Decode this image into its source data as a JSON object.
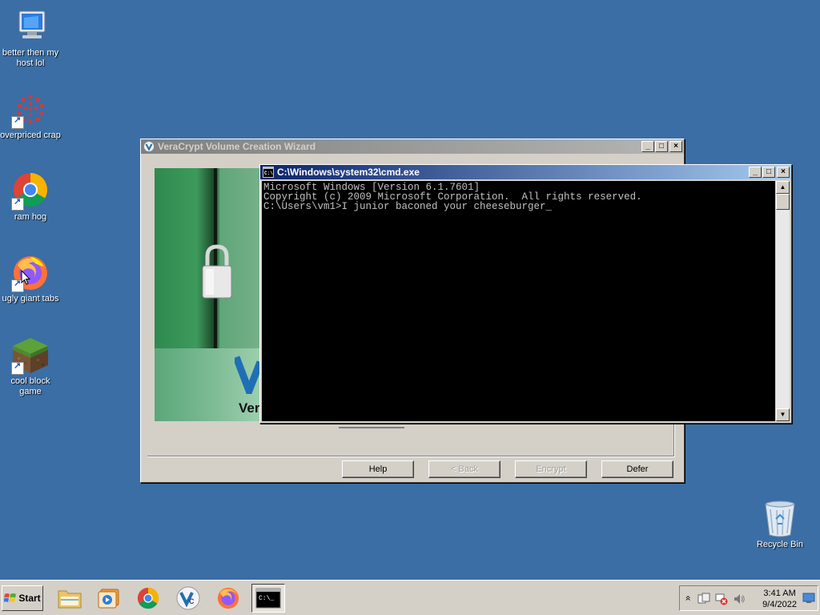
{
  "desktop": {
    "icons": [
      {
        "label": "better then my host lol",
        "icon": "computer-icon"
      },
      {
        "label": "overpriced crap",
        "icon": "red-dots-icon"
      },
      {
        "label": "ram hog",
        "icon": "chrome-icon"
      },
      {
        "label": "ugly giant tabs",
        "icon": "firefox-icon"
      },
      {
        "label": "cool block game",
        "icon": "minecraft-grass-icon"
      },
      {
        "label": "Recycle Bin",
        "icon": "recycle-bin-icon"
      }
    ]
  },
  "veracrypt": {
    "title": "VeraCrypt Volume Creation Wizard",
    "banner_text": "Ver",
    "buttons": {
      "help": "Help",
      "back": "< Back",
      "next": "Encrypt",
      "cancel": "Defer"
    }
  },
  "cmd": {
    "title": "C:\\Windows\\system32\\cmd.exe",
    "lines": [
      "Microsoft Windows [Version 6.1.7601]",
      "Copyright (c) 2009 Microsoft Corporation.  All rights reserved.",
      "",
      "C:\\Users\\vm1>I junior baconed your cheeseburger_"
    ]
  },
  "taskbar": {
    "start_label": "Start",
    "clock_time": "3:41 AM",
    "clock_date": "9/4/2022",
    "tray_chevron": "»"
  },
  "colors": {
    "desktop": "#3a6ea5",
    "active_title": "#0a246a",
    "inactive_title": "#808080"
  }
}
